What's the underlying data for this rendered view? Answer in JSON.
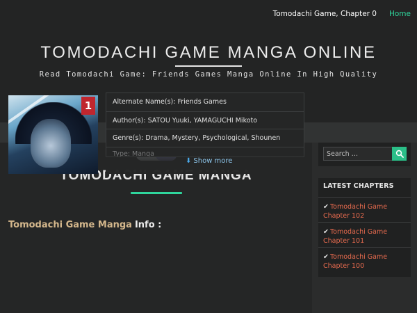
{
  "nav": {
    "chapter_link": "Tomodachi Game, Chapter 0",
    "home_link": "Home"
  },
  "site": {
    "title": "TOMODACHI GAME MANGA ONLINE",
    "description": "Read Tomodachi Game: Friends Games Manga Online In High Quality"
  },
  "main": {
    "page_title": "TOMODACHI GAME MANGA",
    "info_heading": {
      "manga_name": "Tomodachi Game Manga",
      "suffix": "Info :"
    },
    "cover_badge": "1",
    "info_rows": [
      "Alternate Name(s): Friends Games",
      "Author(s): SATOU Yuuki, YAMAGUCHI Mikoto",
      "Genre(s): Drama, Mystery, Psychological, Shounen",
      "Type: Manga"
    ],
    "show_more": "Show more"
  },
  "sidebar": {
    "search": {
      "placeholder": "Search …"
    },
    "latest": {
      "title": "LATEST CHAPTERS",
      "check": "✔",
      "items": [
        "Tomodachi Game Chapter 102",
        "Tomodachi Game Chapter 101",
        "Tomodachi Game Chapter 100"
      ]
    }
  },
  "colors": {
    "accent": "#2fd59c",
    "link": "#e56a4e",
    "heading_gold": "#d4b78c",
    "search_button": "#2bbf88"
  },
  "icons": {
    "search_button": "search-icon",
    "show_more": "arrow-down-icon",
    "latest_items": "checkmark-icon"
  }
}
